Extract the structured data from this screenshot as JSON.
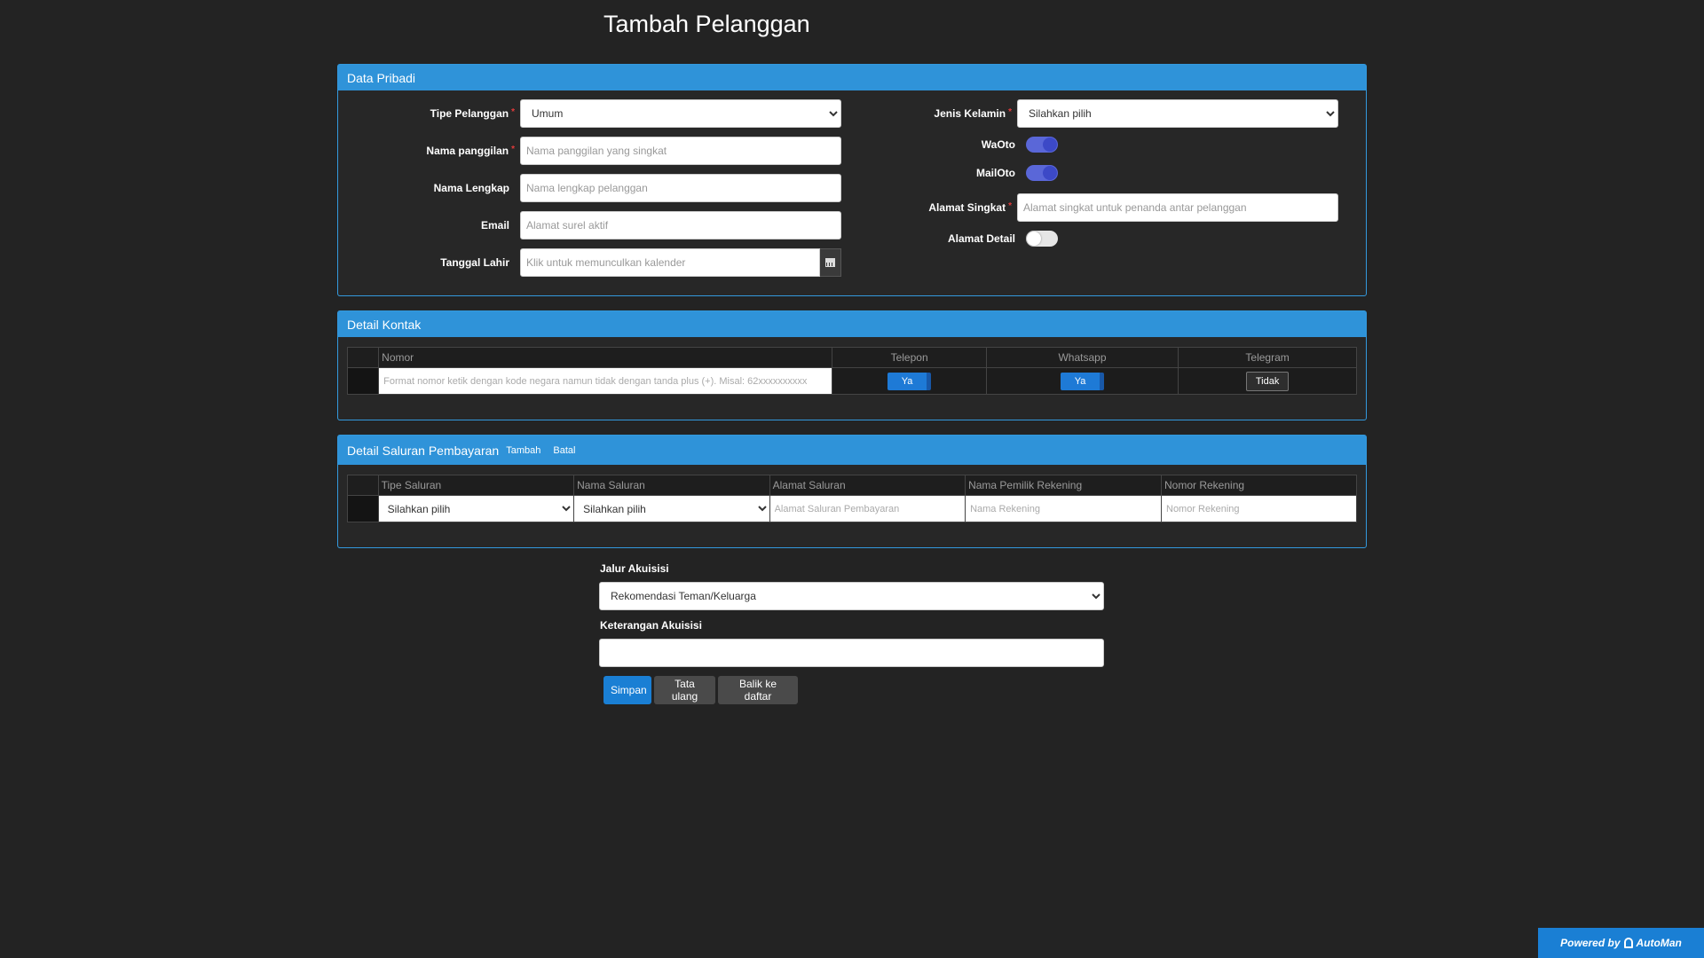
{
  "page": {
    "title": "Tambah Pelanggan"
  },
  "data_pribadi": {
    "heading": "Data Pribadi",
    "tipe_pelanggan": {
      "label": "Tipe Pelanggan",
      "value": "Umum"
    },
    "nama_panggilan": {
      "label": "Nama panggilan",
      "placeholder": "Nama panggilan yang singkat"
    },
    "nama_lengkap": {
      "label": "Nama Lengkap",
      "placeholder": "Nama lengkap pelanggan"
    },
    "email": {
      "label": "Email",
      "placeholder": "Alamat surel aktif"
    },
    "tanggal_lahir": {
      "label": "Tanggal Lahir",
      "placeholder": "Klik untuk memunculkan kalender"
    },
    "jenis_kelamin": {
      "label": "Jenis Kelamin",
      "value": "Silahkan pilih"
    },
    "waoto": {
      "label": "WaOto",
      "on": true
    },
    "mailoto": {
      "label": "MailOto",
      "on": true
    },
    "alamat_singkat": {
      "label": "Alamat Singkat",
      "placeholder": "Alamat singkat untuk penanda antar pelanggan"
    },
    "alamat_detail": {
      "label": "Alamat Detail",
      "on": false
    },
    "required_mark": "*"
  },
  "detail_kontak": {
    "heading": "Detail Kontak",
    "columns": [
      "Nomor",
      "Telepon",
      "Whatsapp",
      "Telegram"
    ],
    "row": {
      "nomor_placeholder": "Format nomor ketik dengan kode negara namun tidak dengan tanda plus (+). Misal: 62xxxxxxxxxx",
      "telepon": "Ya",
      "whatsapp": "Ya",
      "telegram": "Tidak"
    }
  },
  "detail_saluran": {
    "heading": "Detail Saluran Pembayaran",
    "add_link": "Tambah",
    "cancel_link": "Batal",
    "columns": [
      "Tipe Saluran",
      "Nama Saluran",
      "Alamat Saluran",
      "Nama Pemilik Rekening",
      "Nomor Rekening"
    ],
    "row": {
      "tipe_saluran": "Silahkan pilih",
      "nama_saluran": "Silahkan pilih",
      "alamat_placeholder": "Alamat Saluran Pembayaran",
      "pemilik_placeholder": "Nama Rekening",
      "nomor_placeholder": "Nomor Rekening"
    }
  },
  "akuisisi": {
    "jalur_label": "Jalur Akuisisi",
    "jalur_value": "Rekomendasi Teman/Keluarga",
    "keterangan_label": "Keterangan Akuisisi"
  },
  "buttons": {
    "save": "Simpan",
    "reset": "Tata ulang",
    "back": "Balik ke daftar"
  },
  "footer": {
    "powered_by": "Powered by",
    "brand": "AutoMan"
  }
}
